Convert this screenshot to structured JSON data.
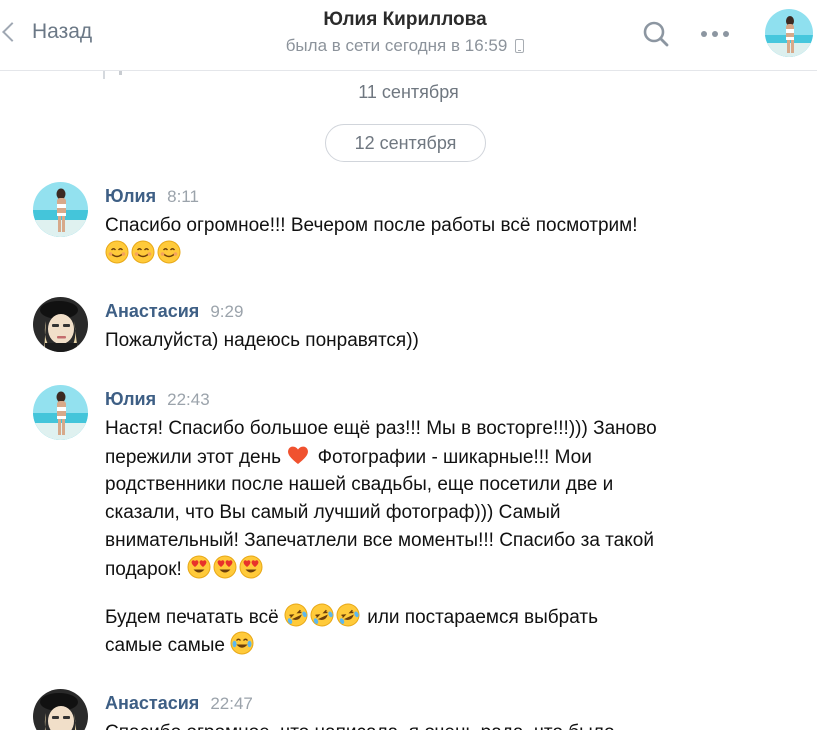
{
  "header": {
    "back_label": "Назад",
    "contact_name": "Юлия Кириллова",
    "status": "была в сети сегодня в 16:59"
  },
  "dates": {
    "previous": "11 сентября",
    "current": "12 сентября"
  },
  "messages": [
    {
      "author": "Юлия",
      "time": "8:11",
      "lines": [
        "Спасибо огромное!!! Вечером после работы всё посмотрим!"
      ],
      "emoji_line": [
        "smiling-face",
        "smiling-face",
        "smiling-face"
      ]
    },
    {
      "author": "Анастасия",
      "time": "9:29",
      "lines": [
        "Пожалуйста) надеюсь понравятся))"
      ]
    },
    {
      "author": "Юлия",
      "time": "22:43",
      "line1": "Настя! Спасибо большое ещё раз!!! Мы в восторге!!!))) Заново",
      "line2_a": "пережили этот день",
      "line2_b": "Фотографии - шикарные!!! Мои",
      "line3": "родственники после нашей свадьбы, еще посетили две и",
      "line4": "сказали, что Вы самый лучший фотограф))) Самый",
      "line5": "внимательный! Запечатлели все моменты!!! Спасибо за такой",
      "line6": "подарок!",
      "para2_line1_a": "Будем печатать всё",
      "para2_line1_b": "или постараемся выбрать",
      "para2_line2": "самые самые"
    },
    {
      "author": "Анастасия",
      "time": "22:47",
      "lines": [
        "Спасибо огромное, что написала, я очень рада, что было"
      ]
    }
  ],
  "colors": {
    "author_name": "#3e5f85",
    "timestamp": "#9ba3ab",
    "heart": "#f0522f",
    "emoji_face": "#ffca3a"
  },
  "icons": [
    "back-chevron-icon",
    "search-icon",
    "more-icon",
    "mobile-phone-icon",
    "smiling-face-emoji",
    "red-heart-emoji",
    "heart-eyes-emoji",
    "rofl-emoji",
    "tears-of-joy-emoji"
  ]
}
